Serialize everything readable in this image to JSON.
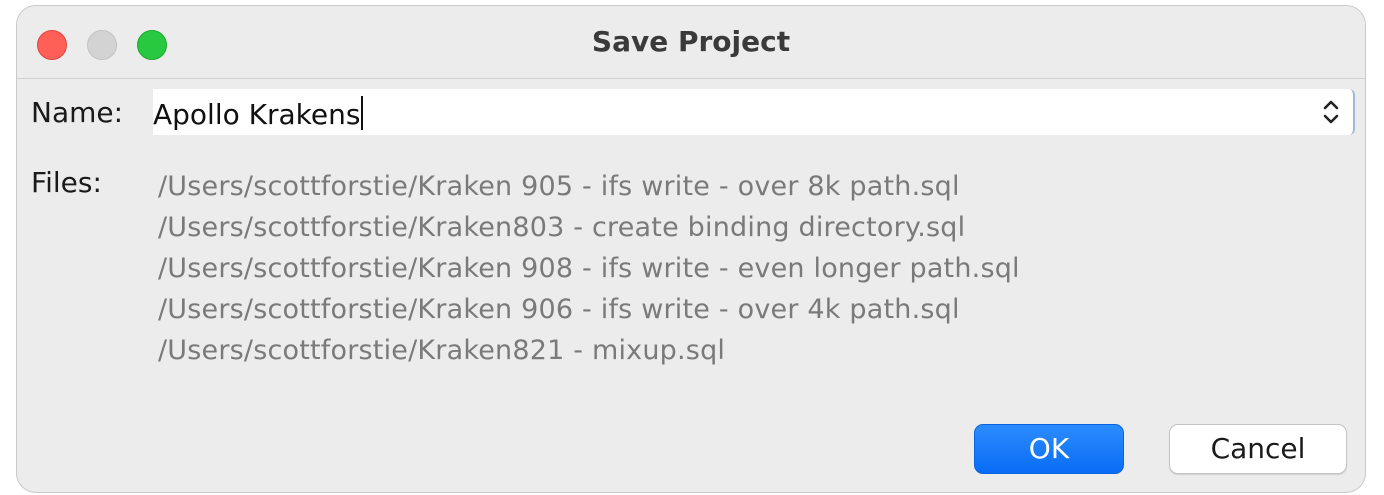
{
  "window": {
    "title": "Save Project"
  },
  "form": {
    "name_label": "Name:",
    "name_value": "Apollo Krakens",
    "files_label": "Files:",
    "files": [
      "/Users/scottforstie/Kraken 905 - ifs write - over 8k path.sql",
      "/Users/scottforstie/Kraken803 - create binding directory.sql",
      "/Users/scottforstie/Kraken 908 - ifs write - even longer path.sql",
      "/Users/scottforstie/Kraken 906 - ifs write - over 4k path.sql",
      "/Users/scottforstie/Kraken821 - mixup.sql"
    ]
  },
  "buttons": {
    "ok_label": "OK",
    "cancel_label": "Cancel"
  },
  "icons": {
    "close": "close-traffic-light",
    "minimize": "minimize-traffic-light",
    "zoom": "zoom-traffic-light",
    "stepper": "up-down-chevron-icon"
  },
  "colors": {
    "accent": "#0a6cf5",
    "close": "#fe5f57",
    "zoom": "#28c840"
  }
}
